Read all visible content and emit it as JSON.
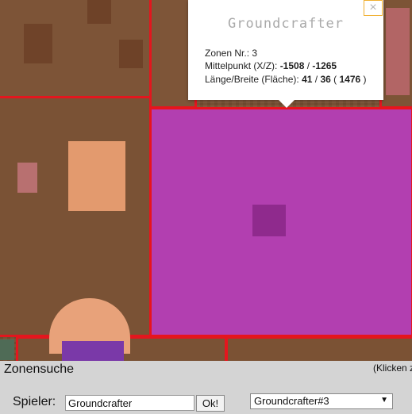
{
  "popup": {
    "title": "Groundcrafter",
    "zone_label": "Zonen Nr.: ",
    "zone_nr": "3",
    "center_label": "Mittelpunkt (X/Z): ",
    "center_x": "-1508",
    "center_sep": " / ",
    "center_z": "-1265",
    "size_label": "Länge/Breite (Fläche): ",
    "length": "41",
    "size_sep": " / ",
    "width": "36",
    "area_open": " ( ",
    "area": "1476",
    "area_close": " )",
    "close_symbol": "×"
  },
  "panel": {
    "title": "Zonensuche",
    "hint": "(Klicken z",
    "player_label": "Spieler:",
    "player_value": "Groundcrafter",
    "ok_label": "Ok!",
    "zone_selected": "Groundcrafter#3",
    "dropdown_arrow": "▼"
  },
  "colors": {
    "zone_border": "#e3161e",
    "selected_zone": "#b23fb0",
    "terrain": "#7b5234"
  }
}
